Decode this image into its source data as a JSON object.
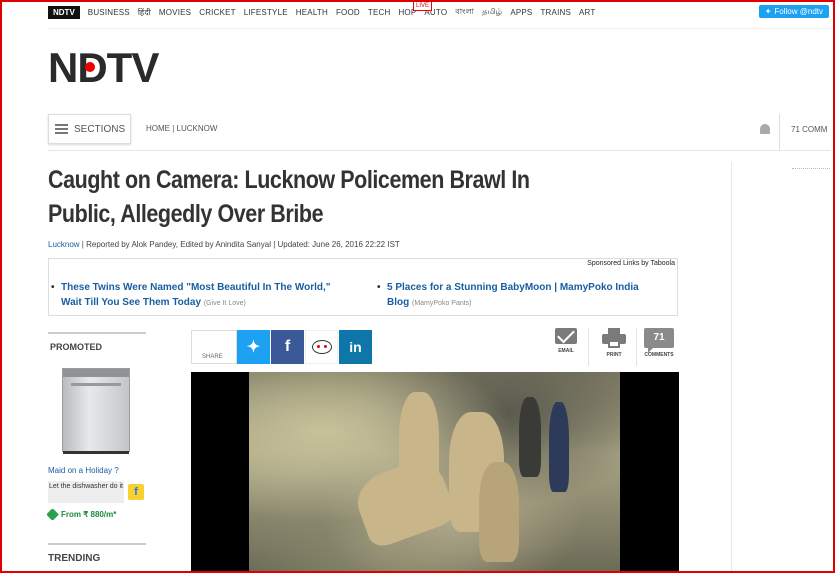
{
  "topnav": {
    "brand": "NDTV",
    "items": [
      "BUSINESS",
      "हिंदी",
      "MOVIES",
      "CRICKET",
      "LIFESTYLE",
      "HEALTH",
      "FOOD",
      "TECH",
      "HOP",
      "AUTO",
      "বাংলা",
      "தமிழ்",
      "APPS",
      "TRAINS",
      "ART"
    ],
    "live_badge": "LIVE",
    "follow_label": "Follow @ndtv"
  },
  "logo": {
    "text": "NDTV"
  },
  "section_bar": {
    "sections_label": "SECTIONS",
    "breadcrumb": "HOME | LUCKNOW",
    "comments_label": "71 COMM"
  },
  "article": {
    "headline": "Caught on Camera: Lucknow Policemen Brawl In Public, Allegedly Over Bribe",
    "meta_place": "Lucknow",
    "meta_rest": " | Reported by Alok Pandey, Edited by Anindita Sanyal | Updated: June 26, 2016 22:22 IST"
  },
  "sponsored": {
    "label": "Sponsored Links by Taboola",
    "items": [
      {
        "title_line1": "These Twins Were Named \"Most Beautiful In The World,\"",
        "title_line2": "Wait Till You See Them Today",
        "source": "(Give It Love)"
      },
      {
        "title_line1": "5 Places for a Stunning BabyMoon | MamyPoko India",
        "title_line2": "Blog",
        "source": "(MamyPoko Pants)"
      }
    ]
  },
  "promoted": {
    "title": "PROMOTED",
    "link": "Maid on a Holiday ?",
    "cta": "Let the dishwasher do it",
    "price": "From ₹ 880/m*"
  },
  "trending": {
    "title": "TRENDING"
  },
  "share": {
    "label": "SHARE",
    "email_label": "EMAIL",
    "print_label": "PRINT",
    "comments_count": "71",
    "comments_label": "COMMENTS"
  },
  "colors": {
    "brand_red": "#e00000",
    "link_blue": "#1a5ea0",
    "twitter": "#1da1f2",
    "facebook": "#3b5998",
    "linkedin": "#0e76a8"
  }
}
